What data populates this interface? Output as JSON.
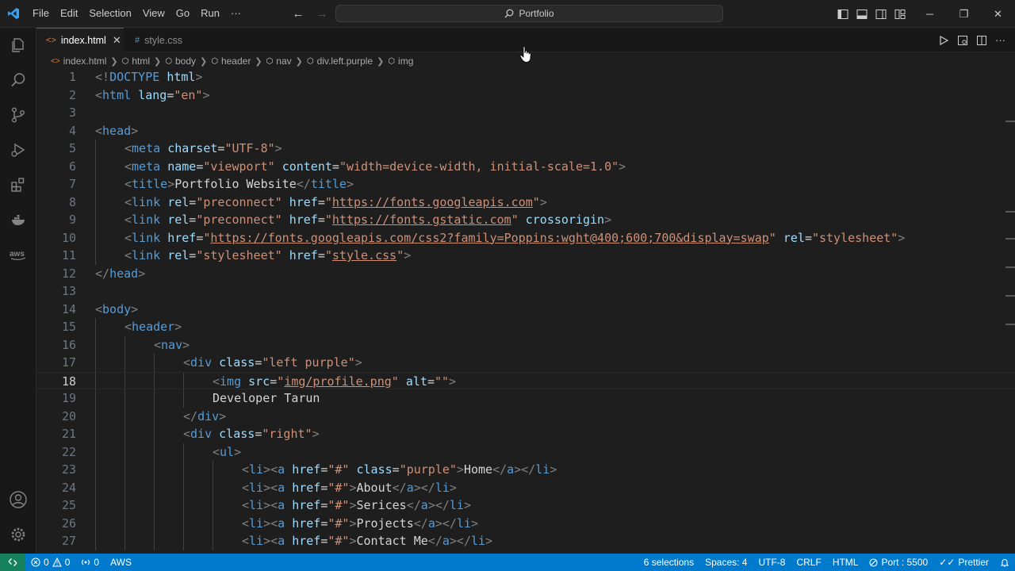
{
  "menu": [
    "File",
    "Edit",
    "Selection",
    "View",
    "Go",
    "Run",
    "···"
  ],
  "search": {
    "label": "Portfolio"
  },
  "tabs": [
    {
      "label": "index.html",
      "icon": "<>",
      "active": true
    },
    {
      "label": "style.css",
      "icon": "#",
      "active": false
    }
  ],
  "breadcrumb": [
    "index.html",
    "html",
    "body",
    "header",
    "nav",
    "div.left.purple",
    "img"
  ],
  "code_lines": [
    {
      "n": "1"
    },
    {
      "n": "2"
    },
    {
      "n": "3"
    },
    {
      "n": "4"
    },
    {
      "n": "5"
    },
    {
      "n": "6"
    },
    {
      "n": "7"
    },
    {
      "n": "8"
    },
    {
      "n": "9"
    },
    {
      "n": "10"
    },
    {
      "n": "11"
    },
    {
      "n": "12"
    },
    {
      "n": "13"
    },
    {
      "n": "14"
    },
    {
      "n": "15"
    },
    {
      "n": "16"
    },
    {
      "n": "17"
    },
    {
      "n": "18"
    },
    {
      "n": "19"
    },
    {
      "n": "20"
    },
    {
      "n": "21"
    },
    {
      "n": "22"
    },
    {
      "n": "23"
    },
    {
      "n": "24"
    },
    {
      "n": "25"
    },
    {
      "n": "26"
    },
    {
      "n": "27"
    }
  ],
  "code": {
    "l1": {
      "t1": "<!",
      "t2": "DOCTYPE",
      "t3": " ",
      "t4": "html",
      "t5": ">"
    },
    "l2": {
      "t1": "<",
      "t2": "html",
      "t3": " ",
      "t4": "lang",
      "t5": "=",
      "t6": "\"en\"",
      "t7": ">"
    },
    "l4": {
      "t1": "<",
      "t2": "head",
      "t3": ">"
    },
    "l5": {
      "t1": "<",
      "t2": "meta",
      "t3": " ",
      "t4": "charset",
      "t5": "=",
      "t6": "\"UTF-8\"",
      "t7": ">"
    },
    "l6": {
      "t1": "<",
      "t2": "meta",
      "t3": " ",
      "t4": "name",
      "t5": "=",
      "t6": "\"viewport\"",
      "t7": " ",
      "t8": "content",
      "t9": "=",
      "t10": "\"width=device-width, initial-scale=1.0\"",
      "t11": ">"
    },
    "l7": {
      "t1": "<",
      "t2": "title",
      "t3": ">",
      "t4": "Portfolio Website",
      "t5": "</",
      "t6": "title",
      "t7": ">"
    },
    "l8": {
      "t1": "<",
      "t2": "link",
      "t3": " ",
      "t4": "rel",
      "t5": "=",
      "t6": "\"preconnect\"",
      "t7": " ",
      "t8": "href",
      "t9": "=",
      "t10": "\"",
      "t11": "https://fonts.googleapis.com",
      "t12": "\"",
      "t13": ">"
    },
    "l9": {
      "t1": "<",
      "t2": "link",
      "t3": " ",
      "t4": "rel",
      "t5": "=",
      "t6": "\"preconnect\"",
      "t7": " ",
      "t8": "href",
      "t9": "=",
      "t10": "\"",
      "t11": "https://fonts.gstatic.com",
      "t12": "\"",
      "t13": " ",
      "t14": "crossorigin",
      "t15": ">"
    },
    "l10": {
      "t1": "<",
      "t2": "link",
      "t3": " ",
      "t4": "href",
      "t5": "=",
      "t6": "\"",
      "t7": "https://fonts.googleapis.com/css2?family=Poppins:wght@400;600;700&display=swap",
      "t8": "\"",
      "t9": " ",
      "t10": "rel",
      "t11": "=",
      "t12": "\"stylesheet\"",
      "t13": ">"
    },
    "l11": {
      "t1": "<",
      "t2": "link",
      "t3": " ",
      "t4": "rel",
      "t5": "=",
      "t6": "\"stylesheet\"",
      "t7": " ",
      "t8": "href",
      "t9": "=",
      "t10": "\"",
      "t11": "style.css",
      "t12": "\"",
      "t13": ">"
    },
    "l12": {
      "t1": "</",
      "t2": "head",
      "t3": ">"
    },
    "l14": {
      "t1": "<",
      "t2": "body",
      "t3": ">"
    },
    "l15": {
      "t1": "<",
      "t2": "header",
      "t3": ">"
    },
    "l16": {
      "t1": "<",
      "t2": "nav",
      "t3": ">"
    },
    "l17": {
      "t1": "<",
      "t2": "div",
      "t3": " ",
      "t4": "class",
      "t5": "=",
      "t6": "\"left purple\"",
      "t7": ">"
    },
    "l18": {
      "t1": "<",
      "t2": "img",
      "t3": " ",
      "t4": "src",
      "t5": "=",
      "t6": "\"",
      "t7": "img/profile.png",
      "t8": "\"",
      "t9": " ",
      "t10": "alt",
      "t11": "=",
      "t12": "\"\"",
      "t13": ">"
    },
    "l19": {
      "t1": "Developer Tarun"
    },
    "l20": {
      "t1": "</",
      "t2": "div",
      "t3": ">"
    },
    "l21": {
      "t1": "<",
      "t2": "div",
      "t3": " ",
      "t4": "class",
      "t5": "=",
      "t6": "\"right\"",
      "t7": ">"
    },
    "l22": {
      "t1": "<",
      "t2": "ul",
      "t3": ">"
    },
    "l23": {
      "t1": "<",
      "t2": "li",
      "t3": "><",
      "t4": "a",
      "t5": " ",
      "t6": "href",
      "t7": "=",
      "t8": "\"#\"",
      "t9": " ",
      "t10": "class",
      "t11": "=",
      "t12": "\"purple\"",
      "t13": ">",
      "t14": "Home",
      "t15": "</",
      "t16": "a",
      "t17": "></",
      "t18": "li",
      "t19": ">"
    },
    "l24": {
      "t1": "<",
      "t2": "li",
      "t3": "><",
      "t4": "a",
      "t5": " ",
      "t6": "href",
      "t7": "=",
      "t8": "\"#\"",
      "t9": ">",
      "t10": "About",
      "t11": "</",
      "t12": "a",
      "t13": "></",
      "t14": "li",
      "t15": ">"
    },
    "l25": {
      "t1": "<",
      "t2": "li",
      "t3": "><",
      "t4": "a",
      "t5": " ",
      "t6": "href",
      "t7": "=",
      "t8": "\"#\"",
      "t9": ">",
      "t10": "Serices",
      "t11": "</",
      "t12": "a",
      "t13": "></",
      "t14": "li",
      "t15": ">"
    },
    "l26": {
      "t1": "<",
      "t2": "li",
      "t3": "><",
      "t4": "a",
      "t5": " ",
      "t6": "href",
      "t7": "=",
      "t8": "\"#\"",
      "t9": ">",
      "t10": "Projects",
      "t11": "</",
      "t12": "a",
      "t13": "></",
      "t14": "li",
      "t15": ">"
    },
    "l27": {
      "t1": "<",
      "t2": "li",
      "t3": "><",
      "t4": "a",
      "t5": " ",
      "t6": "href",
      "t7": "=",
      "t8": "\"#\"",
      "t9": ">",
      "t10": "Contact Me",
      "t11": "</",
      "t12": "a",
      "t13": "></",
      "t14": "li",
      "t15": ">"
    }
  },
  "status": {
    "errors": "0",
    "warnings": "0",
    "ports": "0",
    "aws": "AWS",
    "selections": "6 selections",
    "spaces": "Spaces: 4",
    "encoding": "UTF-8",
    "eol": "CRLF",
    "language": "HTML",
    "port": "Port : 5500",
    "prettier": "Prettier"
  },
  "colors": {
    "accent": "#007acc",
    "remote": "#16825d",
    "tag": "#569cd6",
    "attr": "#9cdcfe",
    "string": "#ce9178"
  }
}
